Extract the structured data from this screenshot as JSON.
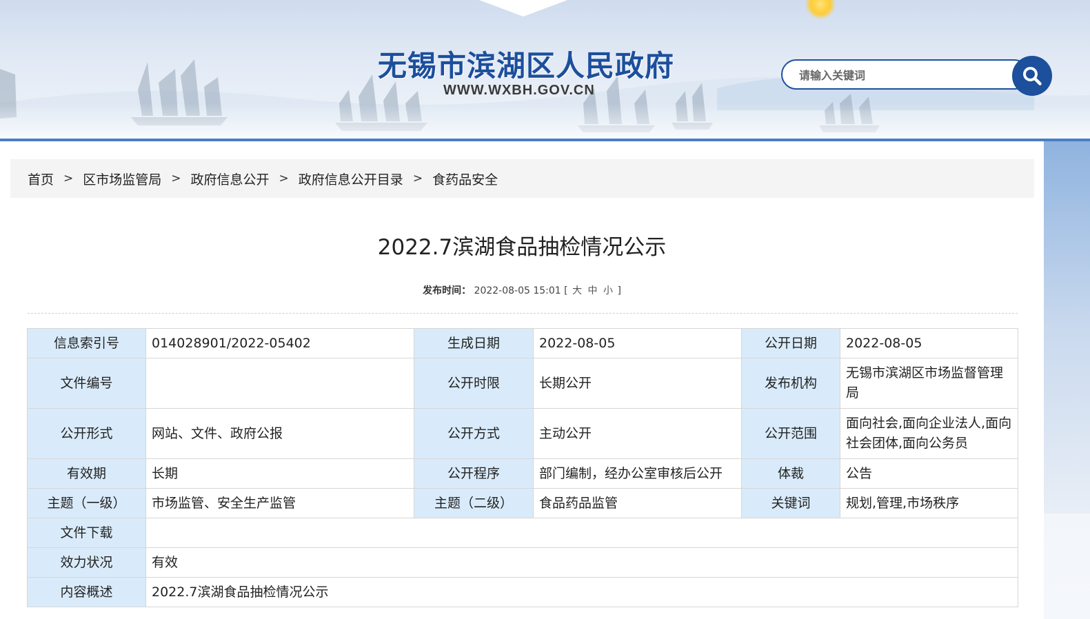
{
  "header": {
    "site_title": "无锡市滨湖区人民政府",
    "site_url": "WWW.WXBH.GOV.CN",
    "search_placeholder": "请输入关键词",
    "search_icon": "search-icon",
    "accent_color": "#1c4f9c"
  },
  "breadcrumb": {
    "items": [
      "首页",
      "区市场监管局",
      "政府信息公开",
      "政府信息公开目录",
      "食药品安全"
    ],
    "separator": ">"
  },
  "article": {
    "title": "2022.7滨湖食品抽检情况公示",
    "publish_label": "发布时间：",
    "publish_time": "2022-08-05 15:01",
    "bracket_open": "[",
    "bracket_close": "]",
    "font_sizes": [
      "大",
      "中",
      "小"
    ]
  },
  "info_table": {
    "label_color": "#d9ebfa",
    "index_label": "信息索引号",
    "index_value": "014028901/2022-05402",
    "created_label": "生成日期",
    "created_value": "2022-08-05",
    "public_date_label": "公开日期",
    "public_date_value": "2022-08-05",
    "doc_no_label": "文件编号",
    "doc_no_value": "",
    "time_limit_label": "公开时限",
    "time_limit_value": "长期公开",
    "issuer_label": "发布机构",
    "issuer_value": "无锡市滨湖区市场监督管理局",
    "form_label": "公开形式",
    "form_value": "网站、文件、政府公报",
    "method_label": "公开方式",
    "method_value": "主动公开",
    "scope_label": "公开范围",
    "scope_value": "面向社会,面向企业法人,面向社会团体,面向公务员",
    "validity_label": "有效期",
    "validity_value": "长期",
    "procedure_label": "公开程序",
    "procedure_value": "部门编制，经办公室审核后公开",
    "genre_label": "体裁",
    "genre_value": "公告",
    "topic1_label": "主题（一级）",
    "topic1_value": "市场监管、安全生产监管",
    "topic2_label": "主题（二级）",
    "topic2_value": "食品药品监管",
    "keyword_label": "关键词",
    "keyword_value": "规划,管理,市场秩序",
    "download_label": "文件下载",
    "download_value": "",
    "status_label": "效力状况",
    "status_value": "有效",
    "summary_label": "内容概述",
    "summary_value": "2022.7滨湖食品抽检情况公示"
  }
}
